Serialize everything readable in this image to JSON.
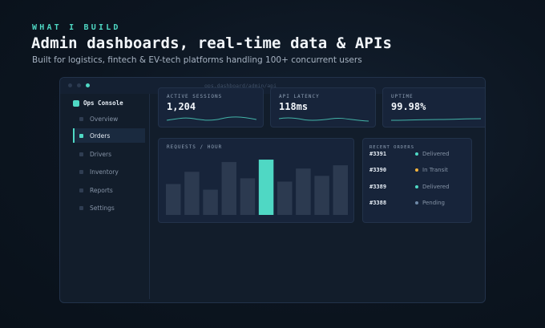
{
  "hero": {
    "eyebrow": "WHAT I BUILD",
    "headline": "Admin dashboards, real-time data & APIs",
    "subline": "Built for logistics, fintech & EV-tech platforms handling 100+ concurrent users"
  },
  "window": {
    "url": "ops.dashboard/admin/api"
  },
  "sidebar": {
    "brand": "Ops Console",
    "items": [
      {
        "label": "Overview",
        "active": false
      },
      {
        "label": "Orders",
        "active": true
      },
      {
        "label": "Drivers",
        "active": false
      },
      {
        "label": "Inventory",
        "active": false
      },
      {
        "label": "Reports",
        "active": false
      },
      {
        "label": "Settings",
        "active": false
      }
    ]
  },
  "stats": [
    {
      "label": "ACTIVE SESSIONS",
      "value": "1,204"
    },
    {
      "label": "API LATENCY",
      "value": "118ms"
    },
    {
      "label": "UPTIME",
      "value": "99.98%"
    }
  ],
  "chart_data": {
    "type": "bar",
    "title": "REQUESTS / HOUR",
    "values": [
      38,
      53,
      31,
      65,
      45,
      68,
      41,
      57,
      48,
      61
    ],
    "highlight_index": 5,
    "ylim": [
      0,
      70
    ],
    "colors": {
      "bar": "#2c3a50",
      "highlight": "#4fd8c4"
    }
  },
  "orders": {
    "title": "RECENT ORDERS",
    "rows": [
      {
        "id": "#3391",
        "status": "Delivered",
        "color": "#4fd8c4"
      },
      {
        "id": "#3390",
        "status": "In Transit",
        "color": "#f2b33d"
      },
      {
        "id": "#3389",
        "status": "Delivered",
        "color": "#4fd8c4"
      },
      {
        "id": "#3388",
        "status": "Pending",
        "color": "#6f8aa8"
      }
    ]
  },
  "colors": {
    "accent": "#4fd8c4",
    "background": "#0c1520",
    "panel": "#17243a"
  }
}
